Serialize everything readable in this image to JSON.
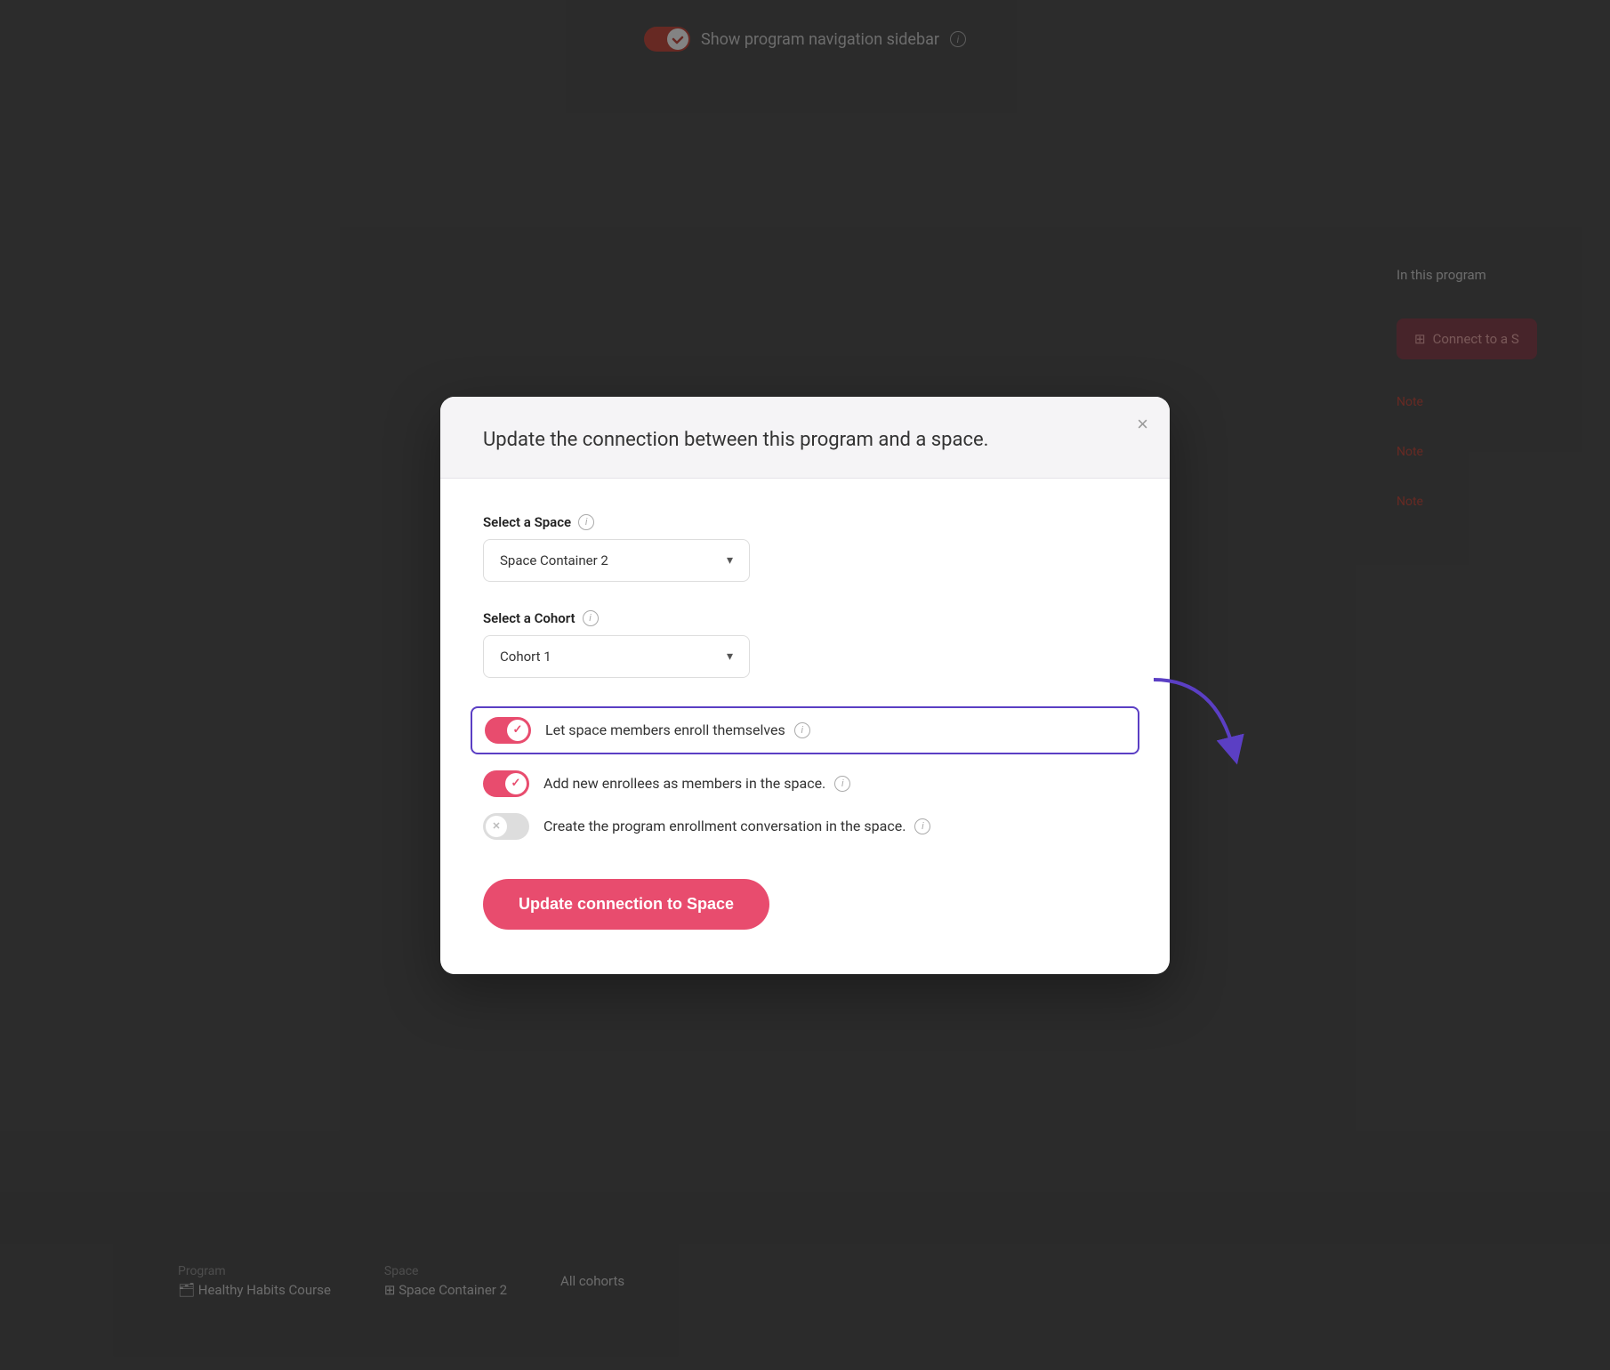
{
  "background": {
    "top_bar": {
      "toggle_label": "Show program navigation sidebar",
      "info_icon": "i"
    }
  },
  "modal": {
    "header": {
      "title": "Update the connection between this program and a space.",
      "close_label": "×"
    },
    "select_space": {
      "label": "Select a Space",
      "info_icon": "i",
      "value": "Space Container 2",
      "chevron": "▾"
    },
    "select_cohort": {
      "label": "Select a Cohort",
      "info_icon": "i",
      "value": "Cohort 1",
      "chevron": "▾"
    },
    "toggles": [
      {
        "id": "let-space-members",
        "state": "on",
        "label": "Let space members enroll themselves",
        "info_icon": "i",
        "highlighted": true
      },
      {
        "id": "add-new-enrollees",
        "state": "on",
        "label": "Add new enrollees as members in the space.",
        "info_icon": "i",
        "highlighted": false
      },
      {
        "id": "create-enrollment-convo",
        "state": "off",
        "label": "Create the program enrollment conversation in the space.",
        "info_icon": "i",
        "highlighted": false
      }
    ],
    "update_button": {
      "label": "Update connection to Space"
    }
  },
  "right_sidebar": {
    "in_this_program": "In this program",
    "connect_btn": "Connect to a S",
    "note_labels": [
      "Note",
      "Note",
      "Note"
    ]
  },
  "bottom_bar": {
    "program_label": "Program",
    "program_icon": "🗂",
    "program_value": "Healthy Habits Course",
    "space_label": "Space",
    "space_icon": "⊞",
    "space_value": "Space Container 2",
    "cohort_value": "All cohorts"
  }
}
